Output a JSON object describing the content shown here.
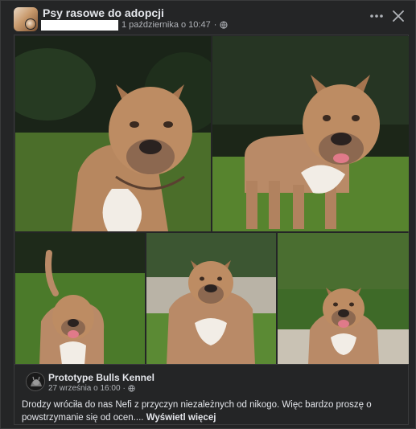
{
  "post": {
    "group_name": "Psy rasowe do adopcji",
    "timestamp": "1 października o 10:47",
    "audience_icon": "globe-icon",
    "more_icon": "more-horizontal-icon",
    "close_icon": "close-icon"
  },
  "shared_post": {
    "author": "Prototype Bulls Kennel",
    "timestamp": "27 września o 16:00",
    "audience_icon": "globe-icon",
    "text": "Drodzy wróciła do nas Nefi z przyczyn niezależnych od nikogo. Więc bardzo proszę o powstrzymanie się od ocen....",
    "see_more": "Wyświetl więcej"
  },
  "colors": {
    "background": "#242526",
    "text_primary": "#e4e6eb",
    "text_secondary": "#b0b3b8",
    "dog_coat": "#b98a67",
    "grass": "#4f7a2c"
  }
}
